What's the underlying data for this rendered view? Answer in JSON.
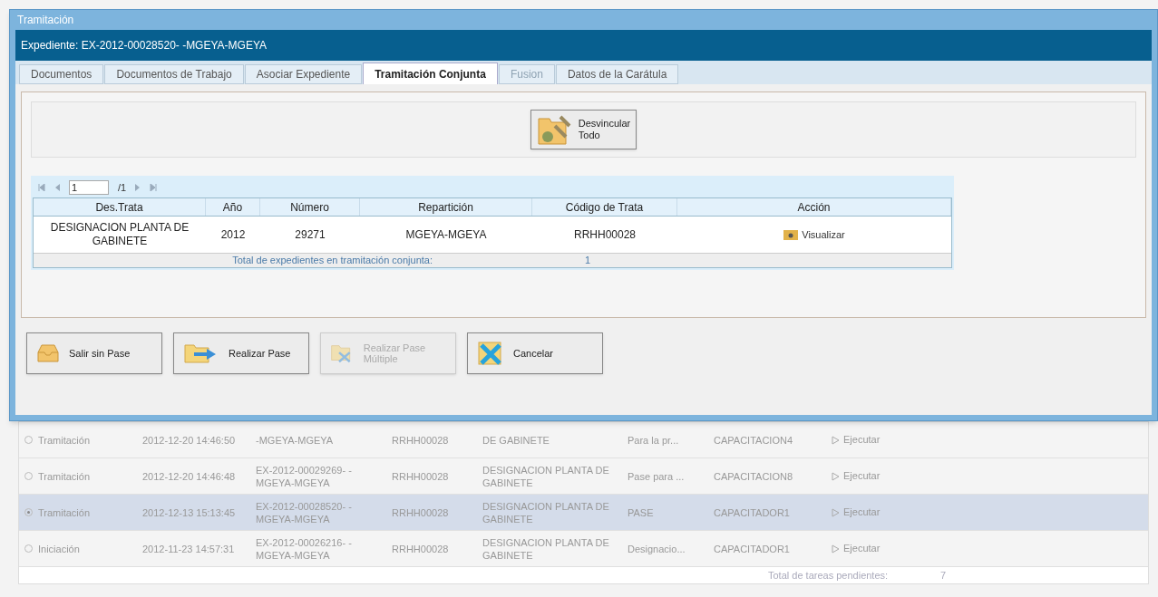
{
  "window": {
    "title": "Tramitación"
  },
  "header": {
    "text": "Expediente: EX-2012-00028520- -MGEYA-MGEYA"
  },
  "tabs": [
    {
      "label": "Documentos",
      "selected": false,
      "disabled": false
    },
    {
      "label": "Documentos de Trabajo",
      "selected": false,
      "disabled": false
    },
    {
      "label": "Asociar Expediente",
      "selected": false,
      "disabled": false
    },
    {
      "label": "Tramitación Conjunta",
      "selected": true,
      "disabled": false
    },
    {
      "label": "Fusion",
      "selected": false,
      "disabled": true
    },
    {
      "label": "Datos de la Carátula",
      "selected": false,
      "disabled": false
    }
  ],
  "unlink_button": {
    "line1": "Desvincular",
    "line2": "Todo"
  },
  "pager": {
    "page": "1",
    "total": "/1"
  },
  "table": {
    "columns": [
      "Des.Trata",
      "Año",
      "Número",
      "Repartición",
      "Código de Trata",
      "Acción"
    ],
    "rows": [
      {
        "cells": [
          "DESIGNACION PLANTA DE GABINETE",
          "2012",
          "29271",
          "MGEYA-MGEYA",
          "RRHH00028"
        ],
        "action": "Visualizar"
      }
    ],
    "footer": {
      "label": "Total de expedientes en tramitación conjunta:",
      "value": "1"
    }
  },
  "buttons": [
    {
      "kind": "inbox",
      "label": "Salir sin Pase",
      "disabled": false
    },
    {
      "kind": "forward",
      "label": "Realizar Pase",
      "disabled": false
    },
    {
      "kind": "multi",
      "label": "Realizar Pase Múltiple",
      "disabled": true
    },
    {
      "kind": "cancel",
      "label": "Cancelar",
      "disabled": false
    }
  ],
  "tasks": {
    "rows": [
      {
        "selected": false,
        "cells": [
          "Tramitación",
          "2012-12-20 14:46:50",
          "-MGEYA-MGEYA",
          "RRHH00028",
          "DE GABINETE",
          "Para la pr...",
          "CAPACITACION4"
        ],
        "action": "Ejecutar"
      },
      {
        "selected": false,
        "cells": [
          "Tramitación",
          "2012-12-20 14:46:48",
          "EX-2012-00029269- -MGEYA-MGEYA",
          "RRHH00028",
          "DESIGNACION PLANTA DE GABINETE",
          "Pase para ...",
          "CAPACITACION8"
        ],
        "action": "Ejecutar"
      },
      {
        "selected": true,
        "cells": [
          "Tramitación",
          "2012-12-13 15:13:45",
          "EX-2012-00028520- -MGEYA-MGEYA",
          "RRHH00028",
          "DESIGNACION PLANTA DE GABINETE",
          "PASE",
          "CAPACITADOR1"
        ],
        "action": "Ejecutar"
      },
      {
        "selected": false,
        "cells": [
          "Iniciación",
          "2012-11-23 14:57:31",
          "EX-2012-00026216- -MGEYA-MGEYA",
          "RRHH00028",
          "DESIGNACION PLANTA DE GABINETE",
          "Designacio...",
          "CAPACITADOR1"
        ],
        "action": "Ejecutar"
      }
    ],
    "footer": {
      "label": "Total de tareas pendientes:",
      "value": "7"
    }
  }
}
